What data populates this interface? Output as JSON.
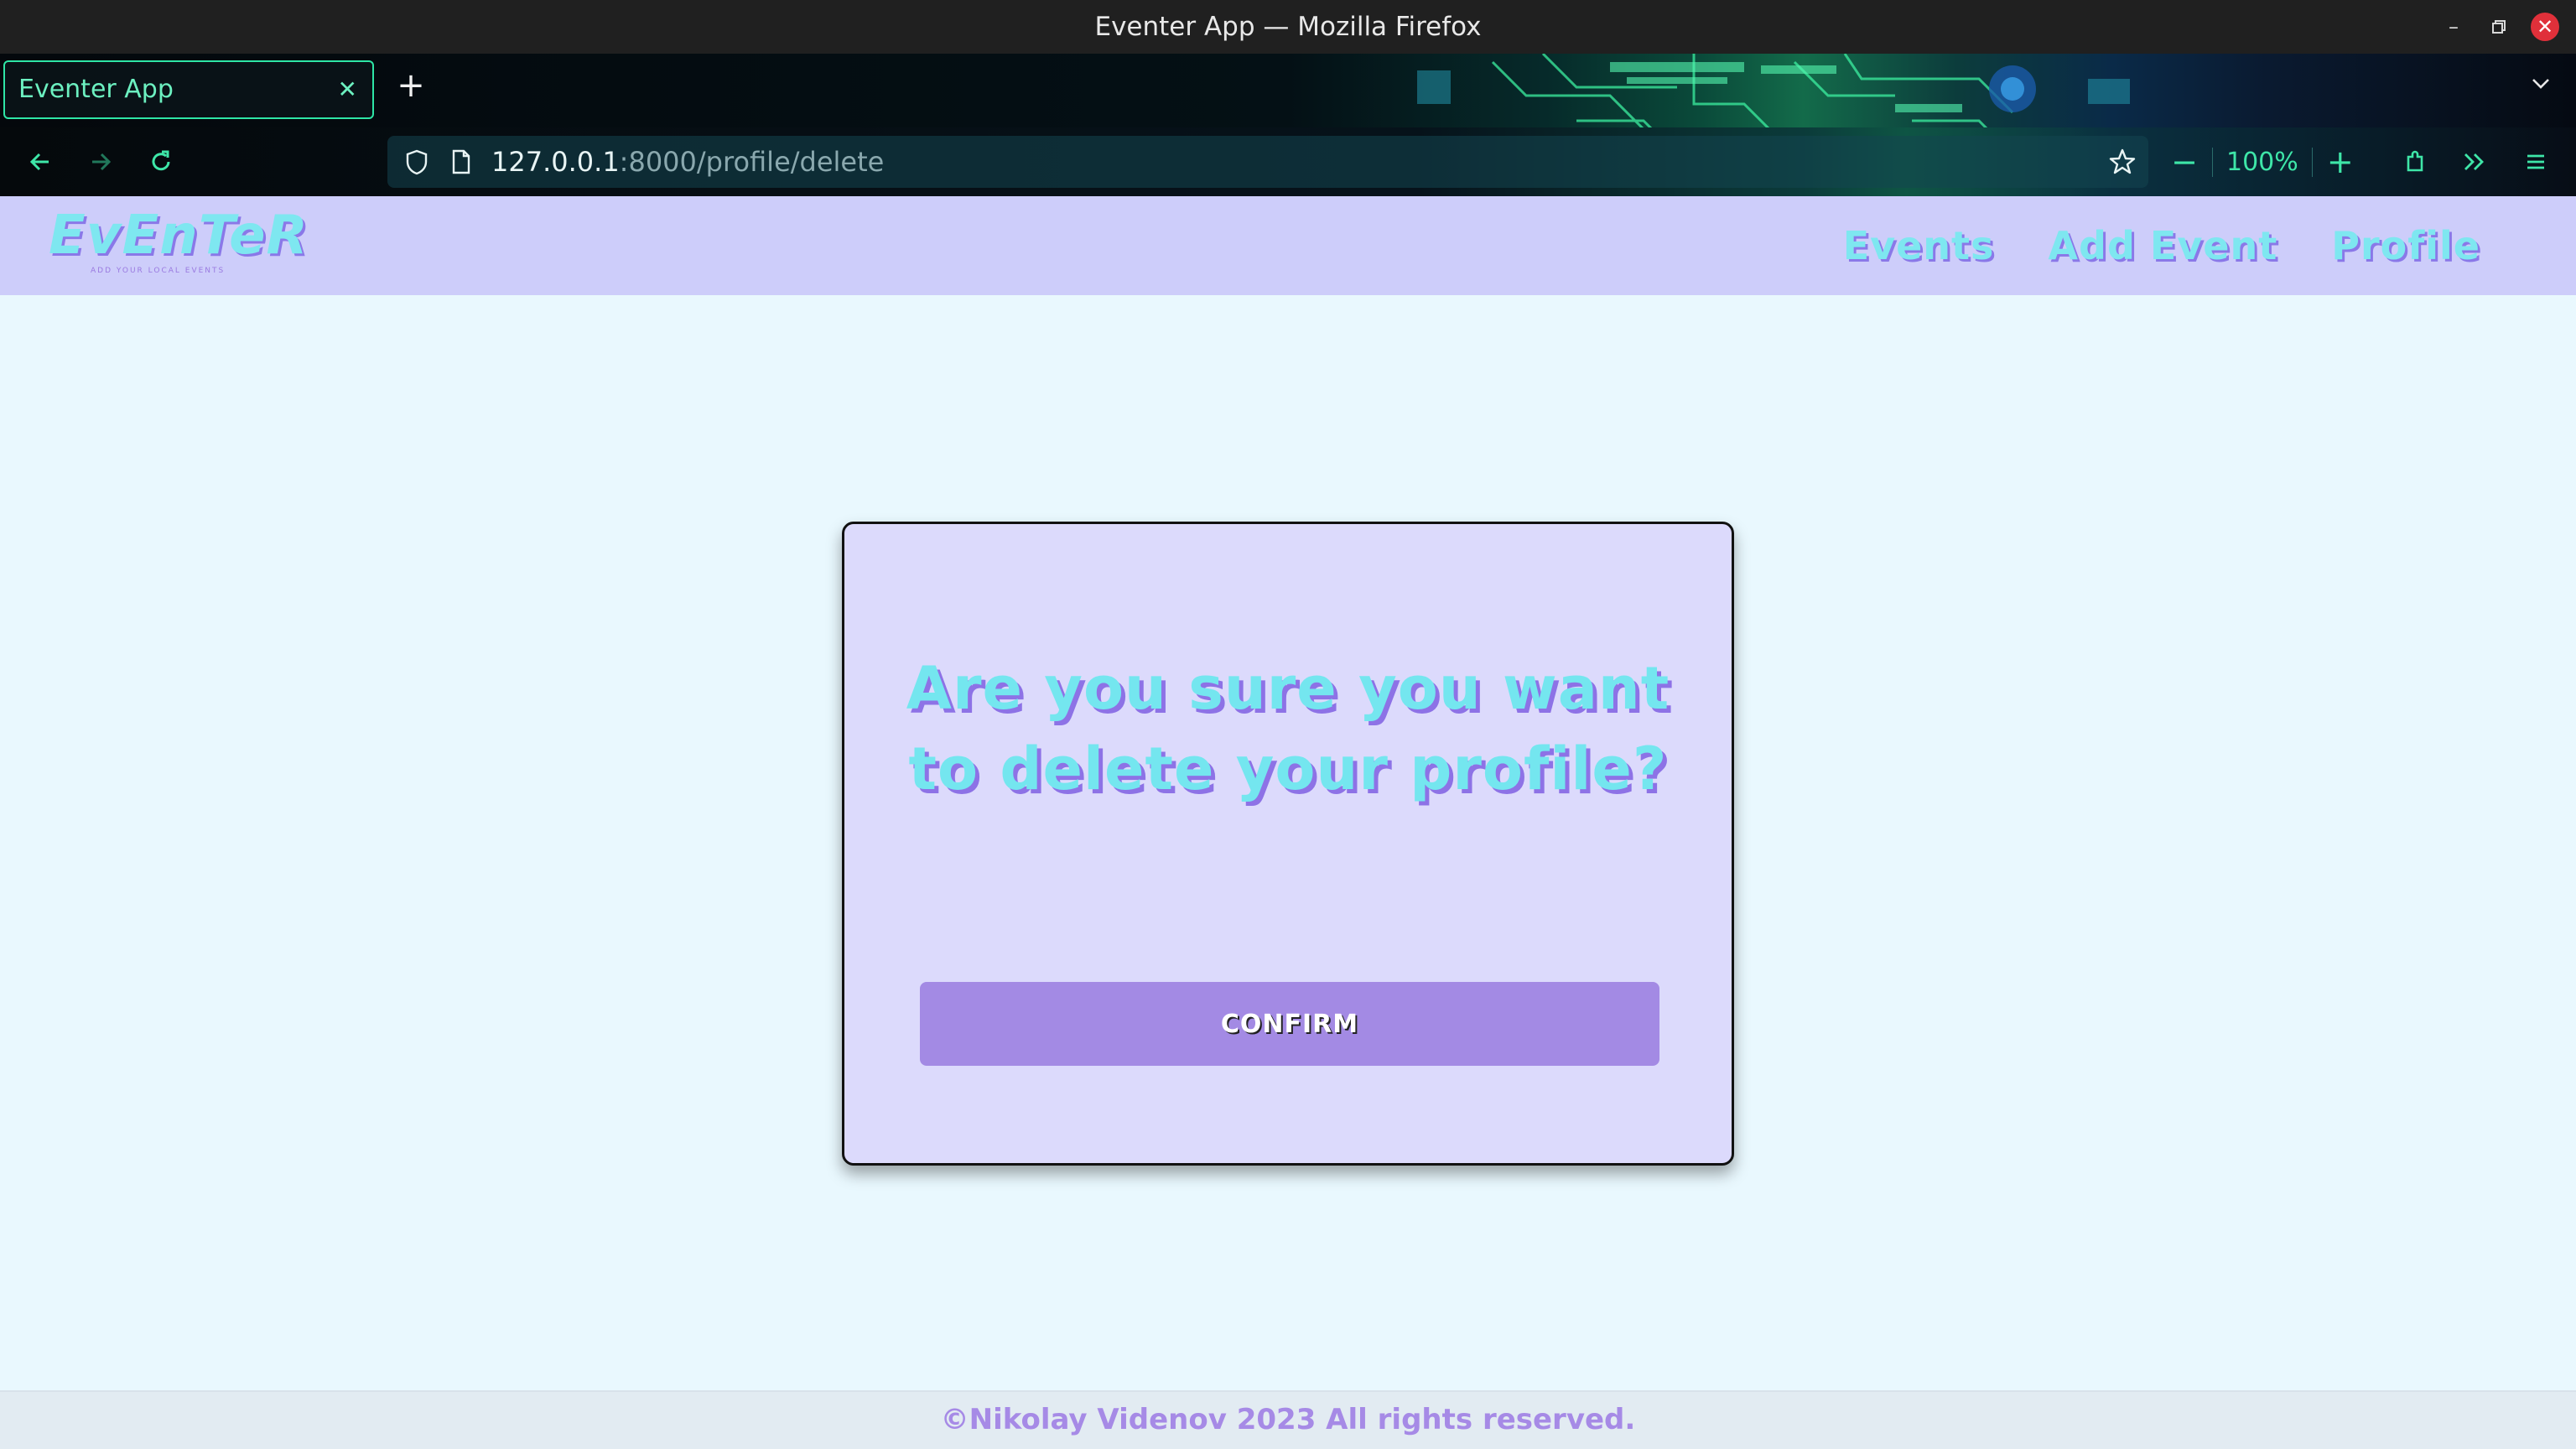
{
  "window": {
    "title": "Eventer App — Mozilla Firefox"
  },
  "browser": {
    "tabs": [
      {
        "label": "Eventer App",
        "active": true
      }
    ],
    "url": {
      "host": "127.0.0.1",
      "rest": ":8000/profile/delete"
    },
    "zoom": "100%"
  },
  "site": {
    "logo": {
      "name": "EvEnTeR",
      "tagline": "ADD YOUR LOCAL EVENTS"
    },
    "nav": [
      {
        "label": "Events"
      },
      {
        "label": "Add Event"
      },
      {
        "label": "Profile"
      }
    ]
  },
  "dialog": {
    "heading": "Are you sure you want to delete your profile?",
    "confirm_label": "CONFIRM"
  },
  "footer": {
    "text": "©Nikolay Videnov 2023 All rights reserved."
  },
  "colors": {
    "accent_text": "#7ee7f0",
    "accent_shadow": "#8a78e8",
    "button": "#a38ae4",
    "header_bg": "#cdcdfa",
    "page_bg": "#e9f8fe"
  }
}
